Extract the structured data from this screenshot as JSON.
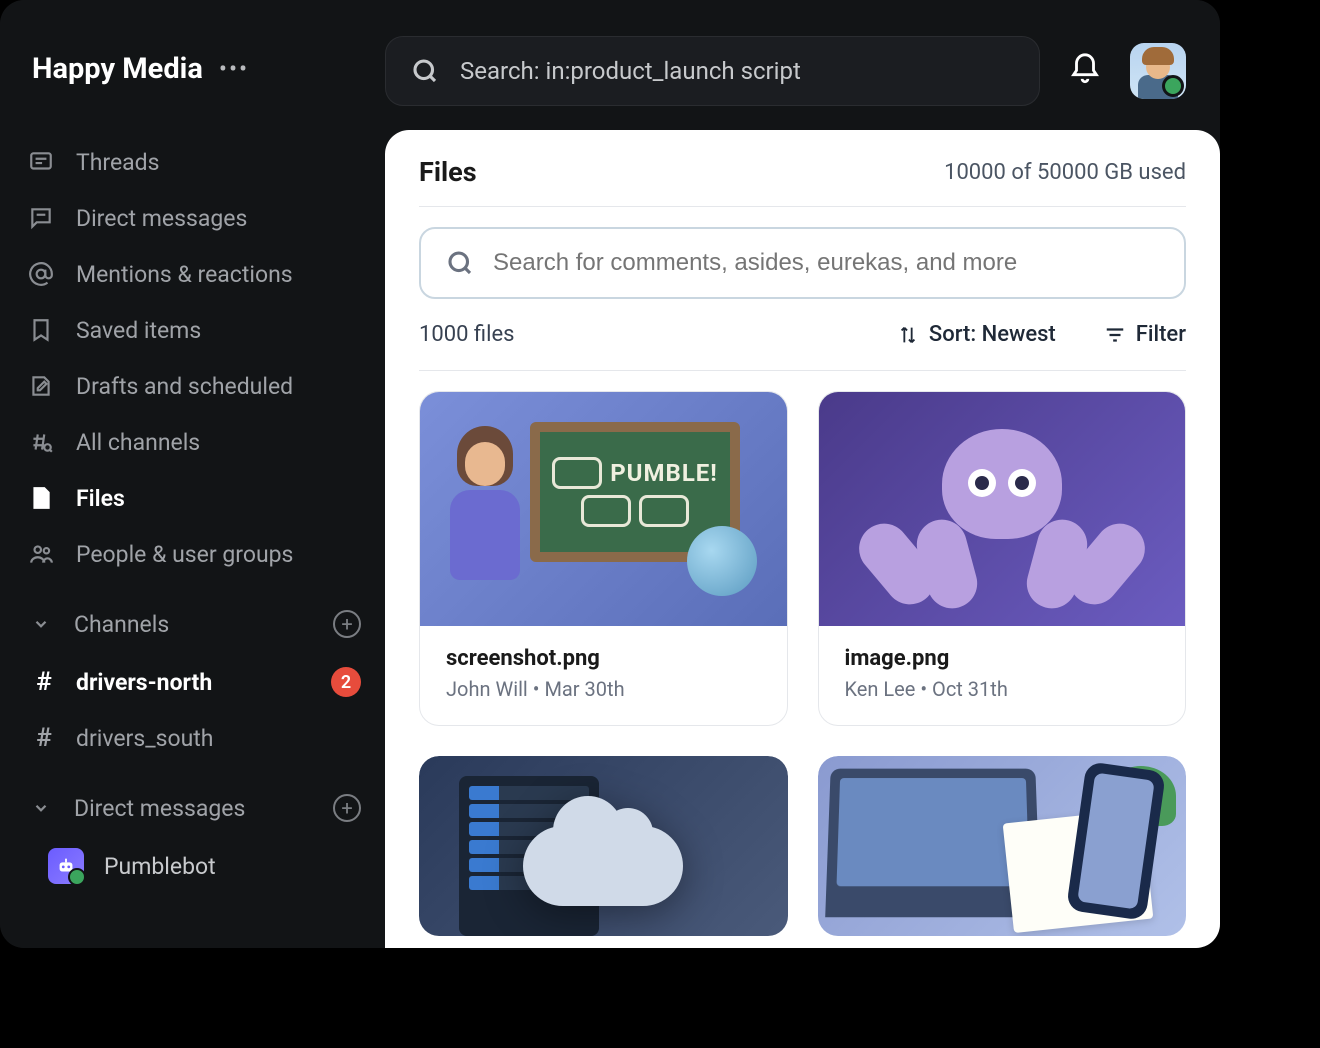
{
  "workspace": {
    "name": "Happy Media"
  },
  "search": {
    "text": "Search: in:product_launch script"
  },
  "nav": {
    "threads": "Threads",
    "dms": "Direct messages",
    "mentions": "Mentions & reactions",
    "saved": "Saved items",
    "drafts": "Drafts and scheduled",
    "allchannels": "All channels",
    "files": "Files",
    "people": "People & user groups"
  },
  "sections": {
    "channels": "Channels",
    "direct": "Direct messages"
  },
  "channels": [
    {
      "name": "drivers-north",
      "unread": true,
      "badge": "2"
    },
    {
      "name": "drivers_south",
      "unread": false
    }
  ],
  "dms": [
    {
      "name": "Pumblebot"
    }
  ],
  "panel": {
    "title": "Files",
    "storage": "10000 of 50000 GB used",
    "search_placeholder": "Search for comments, asides, eurekas, and more",
    "count": "1000 files",
    "sort_label": "Sort: Newest",
    "filter_label": "Filter"
  },
  "files": [
    {
      "name": "screenshot.png",
      "meta": "John Will • Mar 30th"
    },
    {
      "name": "image.png",
      "meta": "Ken Lee • Oct 31th"
    }
  ]
}
